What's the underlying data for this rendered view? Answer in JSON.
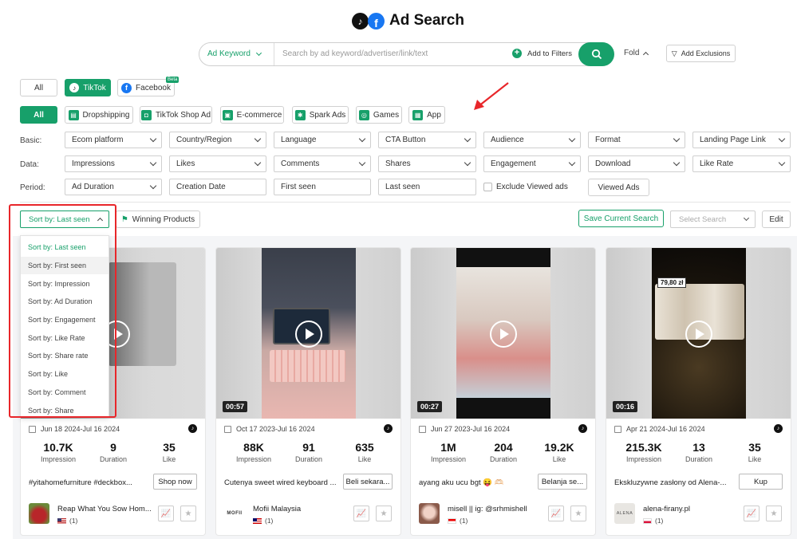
{
  "header": {
    "title": "Ad Search"
  },
  "search": {
    "type_label": "Ad Keyword",
    "placeholder": "Search by ad keyword/advertiser/link/text",
    "add_filters_label": "Add to Filters",
    "fold_label": "Fold",
    "exclusions_label": "Add Exclusions"
  },
  "platforms": {
    "all": "All",
    "tiktok": "TikTok",
    "facebook": "Facebook",
    "beta": "Beta"
  },
  "categories": [
    "All",
    "Dropshipping",
    "TikTok Shop Ad",
    "E-commerce",
    "Spark Ads",
    "Games",
    "App"
  ],
  "filters": {
    "basic_label": "Basic:",
    "basic": [
      "Ecom platform",
      "Country/Region",
      "Language",
      "CTA Button",
      "Audience",
      "Format",
      "Landing Page Link"
    ],
    "data_label": "Data:",
    "data": [
      "Impressions",
      "Likes",
      "Comments",
      "Shares",
      "Engagement",
      "Download",
      "Like Rate"
    ],
    "period_label": "Period:",
    "period": [
      "Ad Duration",
      "Creation Date",
      "First seen",
      "Last seen"
    ],
    "exclude_label": "Exclude Viewed ads",
    "viewed_label": "Viewed Ads"
  },
  "sort": {
    "label": "Sort by: Last seen",
    "winning_label": "Winning Products",
    "save_label": "Save Current Search",
    "select_placeholder": "Select Search",
    "edit_label": "Edit",
    "options": [
      "Sort by: Last seen",
      "Sort by: First seen",
      "Sort by: Impression",
      "Sort by: Ad Duration",
      "Sort by: Engagement",
      "Sort by: Like Rate",
      "Sort by: Share rate",
      "Sort by: Like",
      "Sort by: Comment",
      "Sort by: Share"
    ]
  },
  "cards": [
    {
      "duration": "",
      "date": "Jun 18 2024-Jul 16 2024",
      "impression": "10.7K",
      "days": "9",
      "likes": "35",
      "desc": "#yitahomefurniture #deckbox...",
      "cta": "Shop now",
      "advertiser": "Reap What You Sow Hom...",
      "count": "(1)",
      "stat_labels": [
        "Impression",
        "Duration",
        "Like"
      ]
    },
    {
      "duration": "00:57",
      "date": "Oct 17 2023-Jul 16 2024",
      "impression": "88K",
      "days": "91",
      "likes": "635",
      "desc": "Cutenya sweet wired keyboard ...",
      "cta": "Beli sekara...",
      "advertiser": "Mofii Malaysia",
      "count": "(1)",
      "logo_text": "MOFII",
      "stat_labels": [
        "Impression",
        "Duration",
        "Like"
      ]
    },
    {
      "duration": "00:27",
      "date": "Jun 27 2023-Jul 16 2024",
      "impression": "1M",
      "days": "204",
      "likes": "19.2K",
      "desc": "ayang aku ucu bgt 😝 🫶🏻",
      "cta": "Belanja se...",
      "advertiser": "misell || ig: @srhmishell",
      "count": "(1)",
      "stat_labels": [
        "Impression",
        "Duration",
        "Like"
      ]
    },
    {
      "duration": "00:16",
      "date": "Apr 21 2024-Jul 16 2024",
      "impression": "215.3K",
      "days": "13",
      "likes": "35",
      "desc": "Ekskluzywne zasłony od Alena-...",
      "cta": "Kup",
      "advertiser": "alena-firany.pl",
      "count": "(1)",
      "logo_text": "ALENA",
      "price_tag": "79,80 zł",
      "stat_labels": [
        "Impression",
        "Duration",
        "Like"
      ]
    }
  ],
  "colors": {
    "accent": "#17a06a",
    "highlight": "#e8262a"
  }
}
